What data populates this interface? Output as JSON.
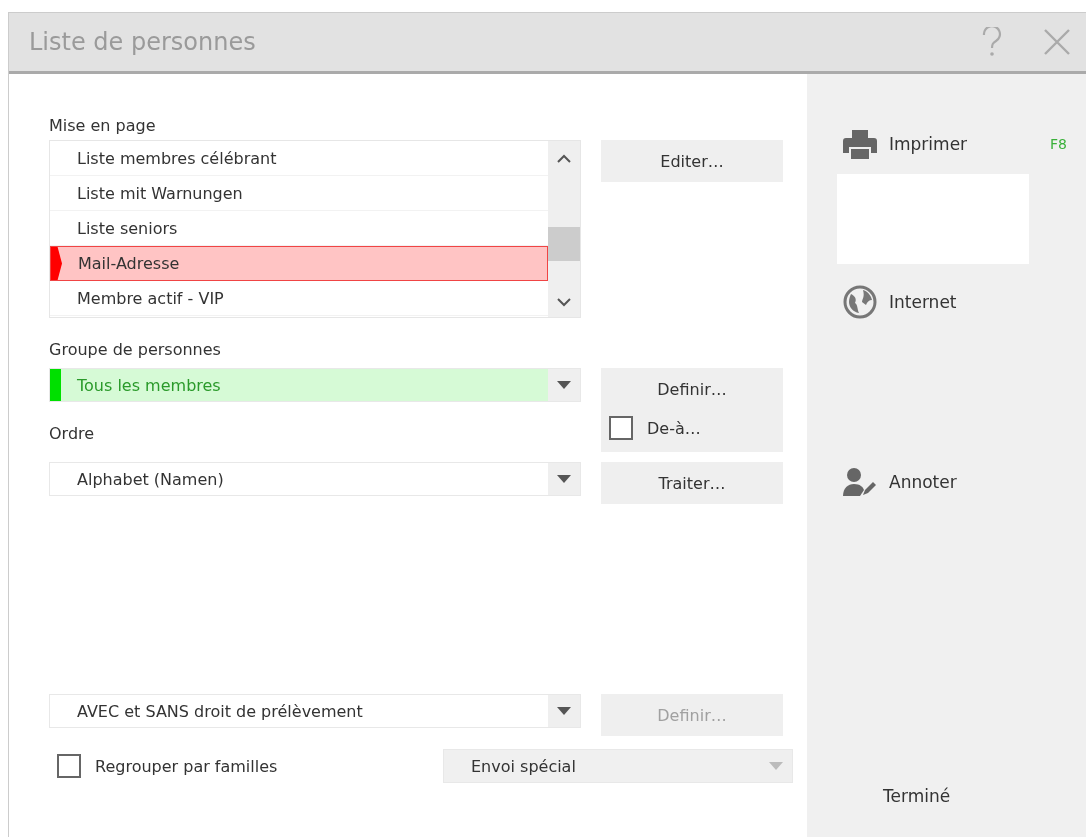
{
  "window": {
    "title": "Liste de personnes"
  },
  "layout": {
    "label": "Mise en page",
    "button": "Editer…",
    "items": [
      {
        "label": "Liste membres célébrant",
        "selected": false
      },
      {
        "label": "Liste mit Warnungen",
        "selected": false
      },
      {
        "label": "Liste seniors",
        "selected": false
      },
      {
        "label": "Mail-Adresse",
        "selected": true
      },
      {
        "label": "Membre actif - VIP",
        "selected": false
      }
    ]
  },
  "group": {
    "label": "Groupe de personnes",
    "value": "Tous les membres",
    "button": "Definir…",
    "range": {
      "label": "De-à…",
      "checked": false
    }
  },
  "order": {
    "label": "Ordre",
    "value": "Alphabet (Namen)",
    "button": "Traiter…"
  },
  "debit": {
    "value": "AVEC et SANS droit de prélèvement",
    "button": {
      "label": "Definir…",
      "disabled": true
    }
  },
  "families": {
    "label": "Regrouper par familles",
    "checked": false
  },
  "special": {
    "value": "Envoi spécial",
    "disabled": true
  },
  "actions": [
    {
      "kind": "print",
      "label": "Imprimer",
      "shortcut": "F8"
    },
    {
      "kind": "internet",
      "label": "Internet"
    },
    {
      "kind": "annotate",
      "label": "Annoter"
    }
  ],
  "done": "Terminé"
}
